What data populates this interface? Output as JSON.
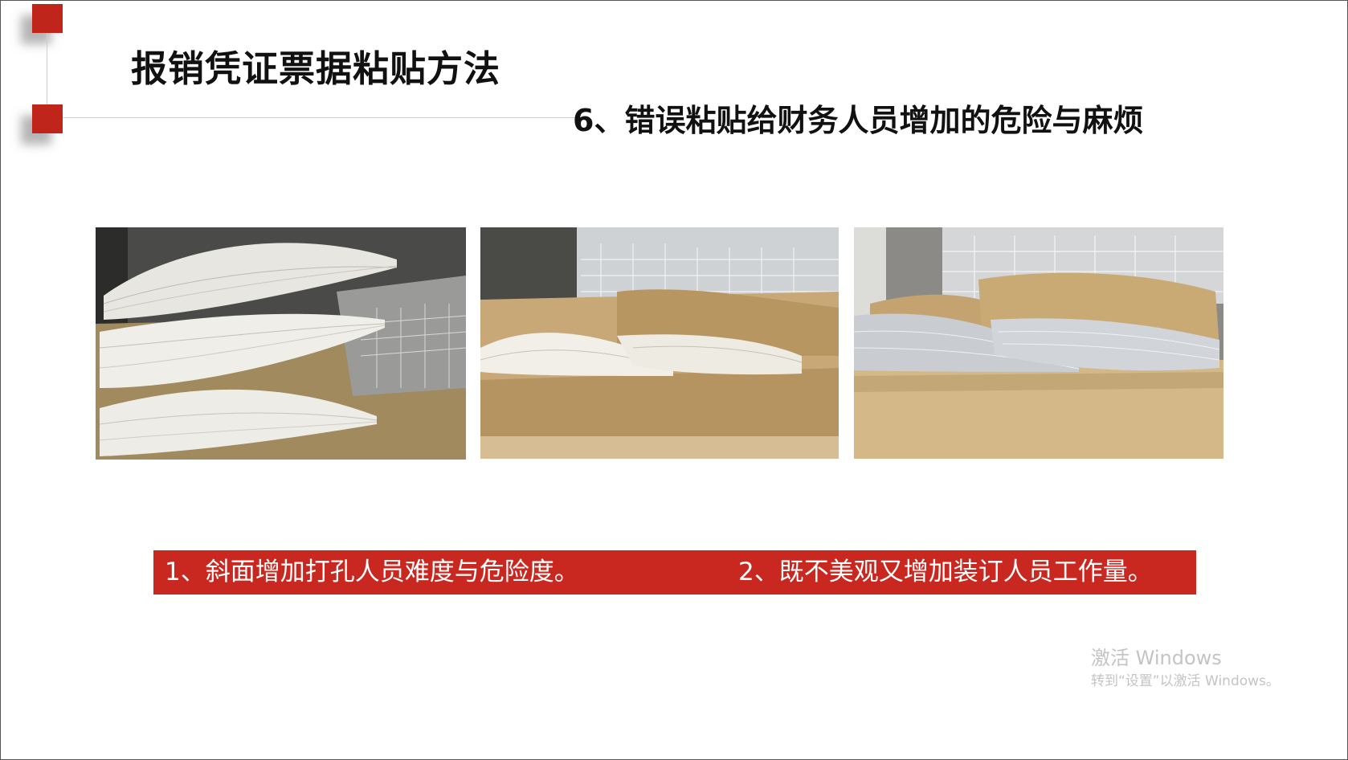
{
  "slide": {
    "title": "报销凭证票据粘贴方法",
    "subtitle": "6、错误粘贴给财务人员增加的危险与麻烦",
    "captions": {
      "left": "1、斜面增加打孔人员难度与危险度。",
      "right": "2、既不美观又增加装订人员工作量。"
    },
    "photos": [
      {
        "name": "stacked-voucher-bundles-photo"
      },
      {
        "name": "two-wedge-voucher-bundles-photo"
      },
      {
        "name": "voucher-bundles-with-covers-photo"
      }
    ]
  },
  "watermark": {
    "title": "激活 Windows",
    "subtitle": "转到“设置”以激活 Windows。"
  },
  "colors": {
    "accent_red": "#c0251c",
    "caption_bar": "#c8281f",
    "title_text": "#111111",
    "watermark_text": "#c4c4c4"
  }
}
